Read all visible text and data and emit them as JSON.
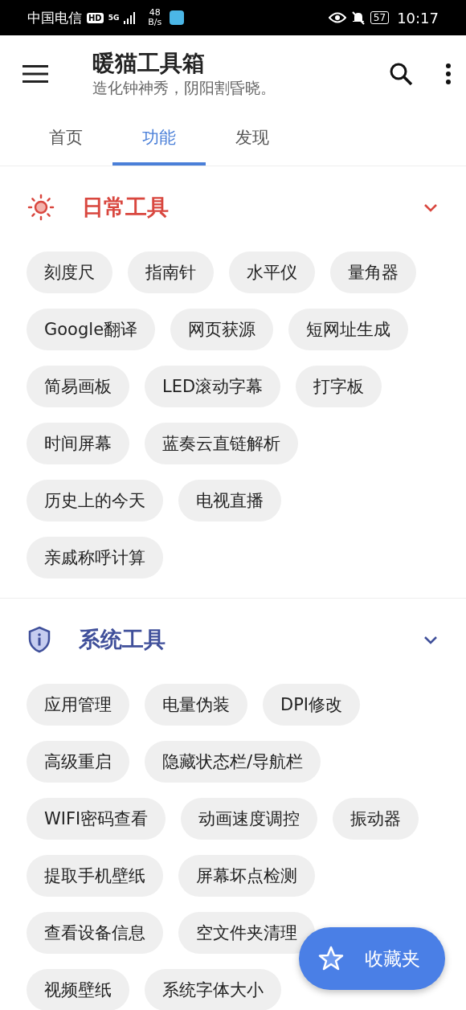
{
  "status_bar": {
    "carrier": "中国电信",
    "hd": "HD",
    "network": "5G",
    "speed_value": "48",
    "speed_unit": "B/s",
    "battery": "57",
    "time": "10:17"
  },
  "app_bar": {
    "title": "暖猫工具箱",
    "subtitle": "造化钟神秀，阴阳割昏晓。"
  },
  "tabs": [
    {
      "label": "首页",
      "selected": false
    },
    {
      "label": "功能",
      "selected": true
    },
    {
      "label": "发现",
      "selected": false
    }
  ],
  "sections": [
    {
      "title": "日常工具",
      "kind": "sun",
      "color": "#d9473f",
      "expanded": true,
      "tools": [
        "刻度尺",
        "指南针",
        "水平仪",
        "量角器",
        "Google翻译",
        "网页获源",
        "短网址生成",
        "简易画板",
        "LED滚动字幕",
        "打字板",
        "时间屏幕",
        "蓝奏云直链解析",
        "历史上的今天",
        "电视直播",
        "亲戚称呼计算"
      ]
    },
    {
      "title": "系统工具",
      "kind": "shield",
      "color": "#3f4f9a",
      "expanded": true,
      "tools": [
        "应用管理",
        "电量伪装",
        "DPI修改",
        "高级重启",
        "隐藏状态栏/导航栏",
        "WIFI密码查看",
        "动画速度调控",
        "振动器",
        "提取手机壁纸",
        "屏幕坏点检测",
        "查看设备信息",
        "空文件夹清理",
        "视频壁纸",
        "系统字体大小"
      ]
    }
  ],
  "fab": {
    "label": "收藏夹"
  }
}
